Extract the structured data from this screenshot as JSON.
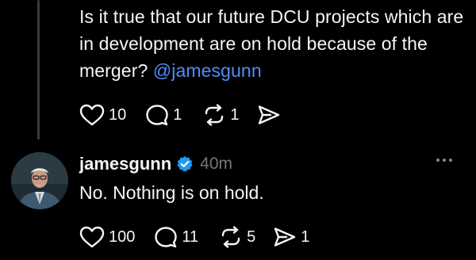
{
  "parent_post": {
    "text": "Is it true that our future DCU projects which are in development are on hold because of the merger? ",
    "mention": "@jamesgunn",
    "actions": {
      "likes": "10",
      "replies": "1",
      "reposts": "1",
      "shares": ""
    }
  },
  "reply": {
    "username": "jamesgunn",
    "verified_icon": "verified-badge-icon",
    "time": "40m",
    "text": "No. Nothing is on hold.",
    "actions": {
      "likes": "100",
      "replies": "11",
      "reposts": "5",
      "shares": "1"
    }
  },
  "colors": {
    "background": "#000000",
    "text": "#f3f5f7",
    "mention": "#4f8df7",
    "muted": "#777777",
    "verified": "#1d9bf0"
  }
}
